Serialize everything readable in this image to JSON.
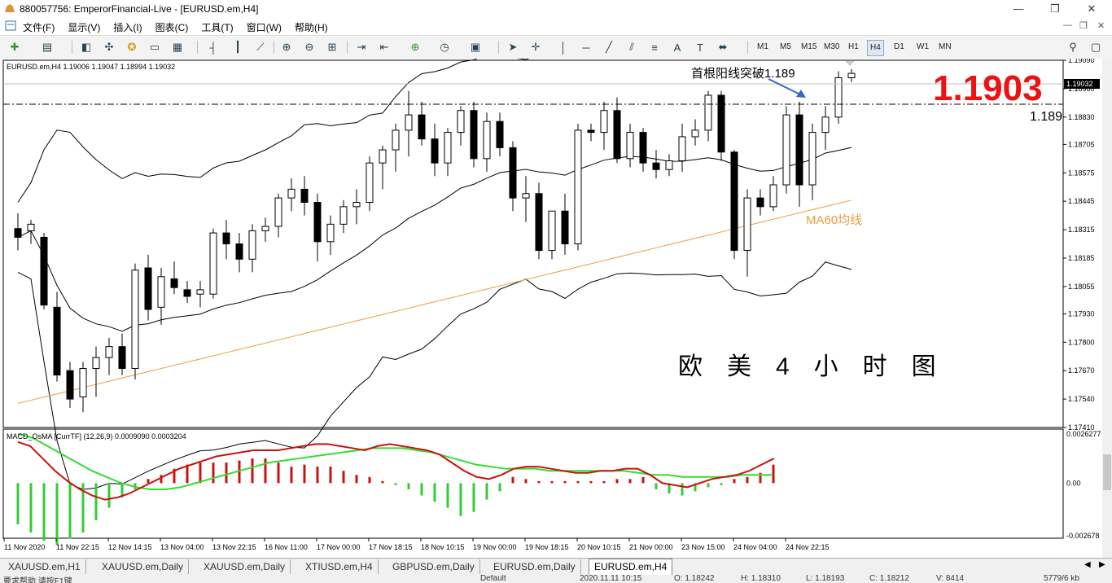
{
  "window": {
    "title": "880057756: EmperorFinancial-Live - [EURUSD.em,H4]",
    "controls": [
      "—",
      "❐",
      "✕"
    ]
  },
  "menu": {
    "items": [
      "文件(F)",
      "显示(V)",
      "插入(I)",
      "图表(C)",
      "工具(T)",
      "窗口(W)",
      "帮助(H)"
    ]
  },
  "toolbar": {
    "timeframes": [
      "M1",
      "M5",
      "M15",
      "M30",
      "H1",
      "H4",
      "D1",
      "W1",
      "MN"
    ],
    "active_timeframe": "H4"
  },
  "chart": {
    "header": "EURUSD.em,H4  1.19006 1.19047 1.18994 1.19032",
    "current_price_tag": "1.19032",
    "annotation_breakout": "首根阳线突破1.189",
    "annotation_price": "1.1903",
    "annotation_level": "1.189",
    "annotation_ma": "MA60均线",
    "annotation_title": "欧　美　4　小　时　图",
    "price_axis": [
      "1.19090",
      "1.18960",
      "1.18830",
      "1.18705",
      "1.18575",
      "1.18445",
      "1.18315",
      "1.18185",
      "1.18055",
      "1.17930",
      "1.17800",
      "1.17670",
      "1.17540",
      "1.17410"
    ],
    "macd_header": "MACD_OsMA [CurrTF] (12,26,9) 0.0009090 0.0003204",
    "macd_axis": [
      "0.0026277",
      "0.00",
      "-0.002678"
    ],
    "time_axis": [
      "11 Nov 2020",
      "11 Nov 22:15",
      "12 Nov 14:15",
      "13 Nov 04:00",
      "13 Nov 22:15",
      "16 Nov 11:00",
      "17 Nov 00:00",
      "17 Nov 18:15",
      "18 Nov 10:15",
      "19 Nov 00:00",
      "19 Nov 18:15",
      "20 Nov 10:15",
      "21 Nov 00:00",
      "23 Nov 15:00",
      "24 Nov 04:00",
      "24 Nov 22:15"
    ],
    "colors": {
      "bull": "#ffffff",
      "bear": "#000000",
      "ma60": "#e8a040",
      "macd_signal": "#33dd33",
      "macd_main": "#cc1111",
      "hist_pos": "#cc1111",
      "hist_neg": "#33cc33",
      "annotation_red": "#ee1111",
      "arrow": "#3366cc"
    }
  },
  "tabs": [
    "XAUUSD.em,H1",
    "XAUUSD.em,Daily",
    "XAUUSD.em,Daily",
    "XTIUSD.em,H4",
    "GBPUSD.em,Daily",
    "EURUSD.em,Daily",
    "EURUSD.em,H4"
  ],
  "active_tab": "EURUSD.em,H4",
  "status": {
    "help": "要求帮助,请按F1键",
    "profile": "Default",
    "datetime": "2020.11.11 10:15",
    "open": "O: 1.18242",
    "high": "H: 1.18310",
    "low": "L: 1.18193",
    "close": "C: 1.18212",
    "volume": "V: 8414",
    "traffic": "5779/6 kb"
  },
  "chart_data": {
    "type": "candlestick",
    "symbol": "EURUSD.em",
    "timeframe": "H4",
    "ylim": [
      1.1741,
      1.1909
    ],
    "candles": [
      [
        1.1832,
        1.1839,
        1.1822,
        1.1828
      ],
      [
        1.1831,
        1.1836,
        1.1825,
        1.1834
      ],
      [
        1.1828,
        1.183,
        1.1795,
        1.1797
      ],
      [
        1.1796,
        1.1803,
        1.1762,
        1.1765
      ],
      [
        1.1767,
        1.1771,
        1.175,
        1.1754
      ],
      [
        1.1755,
        1.1771,
        1.1748,
        1.1768
      ],
      [
        1.1768,
        1.1778,
        1.1755,
        1.1773
      ],
      [
        1.1773,
        1.1782,
        1.1765,
        1.1778
      ],
      [
        1.1778,
        1.1784,
        1.1765,
        1.1768
      ],
      [
        1.1768,
        1.1816,
        1.1763,
        1.1813
      ],
      [
        1.1814,
        1.182,
        1.179,
        1.1795
      ],
      [
        1.1796,
        1.1814,
        1.1788,
        1.181
      ],
      [
        1.1809,
        1.1817,
        1.1802,
        1.1805
      ],
      [
        1.1804,
        1.1808,
        1.1798,
        1.1801
      ],
      [
        1.1802,
        1.1808,
        1.1796,
        1.1804
      ],
      [
        1.1802,
        1.1832,
        1.18,
        1.183
      ],
      [
        1.183,
        1.1836,
        1.1818,
        1.1825
      ],
      [
        1.1825,
        1.183,
        1.1812,
        1.1818
      ],
      [
        1.1818,
        1.1834,
        1.1812,
        1.1831
      ],
      [
        1.1831,
        1.1837,
        1.1826,
        1.1833
      ],
      [
        1.1833,
        1.1848,
        1.1828,
        1.1846
      ],
      [
        1.1846,
        1.1855,
        1.184,
        1.185
      ],
      [
        1.185,
        1.1856,
        1.1838,
        1.1844
      ],
      [
        1.1844,
        1.1848,
        1.1817,
        1.1826
      ],
      [
        1.1826,
        1.1838,
        1.182,
        1.1834
      ],
      [
        1.1834,
        1.1845,
        1.183,
        1.1842
      ],
      [
        1.1842,
        1.185,
        1.1834,
        1.1844
      ],
      [
        1.1844,
        1.1865,
        1.184,
        1.1862
      ],
      [
        1.1862,
        1.187,
        1.185,
        1.1868
      ],
      [
        1.1868,
        1.188,
        1.1858,
        1.1877
      ],
      [
        1.1877,
        1.1895,
        1.1865,
        1.1884
      ],
      [
        1.1884,
        1.189,
        1.187,
        1.1873
      ],
      [
        1.1873,
        1.188,
        1.1856,
        1.1862
      ],
      [
        1.1862,
        1.1878,
        1.1856,
        1.1876
      ],
      [
        1.1876,
        1.1888,
        1.187,
        1.1886
      ],
      [
        1.1886,
        1.189,
        1.186,
        1.1864
      ],
      [
        1.1864,
        1.1885,
        1.1858,
        1.1881
      ],
      [
        1.1881,
        1.1885,
        1.1865,
        1.1869
      ],
      [
        1.1869,
        1.1872,
        1.184,
        1.1846
      ],
      [
        1.1846,
        1.1856,
        1.1835,
        1.1848
      ],
      [
        1.1848,
        1.1853,
        1.1818,
        1.1822
      ],
      [
        1.1822,
        1.184,
        1.1818,
        1.184
      ],
      [
        1.184,
        1.1848,
        1.182,
        1.1825
      ],
      [
        1.1825,
        1.188,
        1.1822,
        1.1877
      ],
      [
        1.1877,
        1.188,
        1.1872,
        1.1876
      ],
      [
        1.1876,
        1.189,
        1.1868,
        1.1886
      ],
      [
        1.1886,
        1.1892,
        1.1862,
        1.1864
      ],
      [
        1.1864,
        1.188,
        1.186,
        1.1876
      ],
      [
        1.1876,
        1.1878,
        1.1858,
        1.1862
      ],
      [
        1.1862,
        1.1868,
        1.1855,
        1.1859
      ],
      [
        1.1859,
        1.1866,
        1.1856,
        1.1863
      ],
      [
        1.1863,
        1.188,
        1.1858,
        1.1874
      ],
      [
        1.1874,
        1.1882,
        1.187,
        1.1877
      ],
      [
        1.1877,
        1.1895,
        1.1872,
        1.1893
      ],
      [
        1.1893,
        1.1895,
        1.1863,
        1.1867
      ],
      [
        1.1867,
        1.1868,
        1.1818,
        1.1822
      ],
      [
        1.1822,
        1.185,
        1.181,
        1.1846
      ],
      [
        1.1846,
        1.185,
        1.1838,
        1.1842
      ],
      [
        1.1842,
        1.1856,
        1.184,
        1.1852
      ],
      [
        1.1852,
        1.1888,
        1.1848,
        1.1884
      ],
      [
        1.1884,
        1.189,
        1.1842,
        1.1852
      ],
      [
        1.1852,
        1.188,
        1.1845,
        1.1876
      ],
      [
        1.1876,
        1.1888,
        1.1868,
        1.1883
      ],
      [
        1.1883,
        1.1904,
        1.188,
        1.1901
      ],
      [
        1.1901,
        1.1905,
        1.1899,
        1.1903
      ]
    ],
    "macd_main": [
      0.002,
      0.0018,
      0.0012,
      0.0006,
      0.0001,
      -0.0003,
      -0.0006,
      -0.0008,
      -0.0007,
      -0.0005,
      -0.0002,
      0.0001,
      0.0004,
      0.0007,
      0.0009,
      0.0011,
      0.0013,
      0.0014,
      0.0015,
      0.0016,
      0.0016,
      0.0016,
      0.0017,
      0.0018,
      0.0019,
      0.0019,
      0.0018,
      0.0017,
      0.0016,
      0.0018,
      0.0019,
      0.0018,
      0.0017,
      0.0016,
      0.0014,
      0.001,
      0.0006,
      0.0003,
      0.0002,
      0.0004,
      0.0007,
      0.0008,
      0.0008,
      0.0007,
      0.0006,
      0.0005,
      0.0005,
      0.0006,
      0.0006,
      0.0007,
      0.0007,
      0.0004,
      0.0,
      -0.0001,
      -0.0002,
      0.0,
      0.0002,
      0.0003,
      0.0004,
      0.0006,
      0.0009,
      0.0012
    ],
    "macd_signal": [
      0.0024,
      0.0022,
      0.0018,
      0.0014,
      0.001,
      0.0006,
      0.0003,
      0.0,
      -0.0002,
      -0.0003,
      -0.0003,
      -0.0002,
      0.0,
      0.0002,
      0.0004,
      0.0006,
      0.0008,
      0.001,
      0.0011,
      0.0012,
      0.0013,
      0.0014,
      0.0015,
      0.0016,
      0.0017,
      0.0017,
      0.0017,
      0.0016,
      0.0015,
      0.0013,
      0.0011,
      0.0009,
      0.0008,
      0.0007,
      0.0007,
      0.0007,
      0.0006,
      0.0006,
      0.0006,
      0.0006,
      0.0006,
      0.0006,
      0.0005,
      0.0004,
      0.0004,
      0.0003,
      0.0003,
      0.0003,
      0.0003,
      0.0004,
      0.0004,
      0.0004
    ],
    "macd_hist": [
      -0.002,
      -0.0024,
      -0.0028,
      -0.003,
      -0.0027,
      -0.0024,
      -0.0018,
      -0.0012,
      -0.0007,
      -0.0003,
      0.0002,
      0.0004,
      0.0007,
      0.0009,
      0.001,
      0.001,
      0.001,
      0.0011,
      0.0012,
      0.0012,
      0.001,
      0.0008,
      0.0009,
      0.0008,
      0.0008,
      0.0006,
      0.0004,
      0.0003,
      0.0001,
      -0.0001,
      -0.0003,
      -0.0006,
      -0.0009,
      -0.0012,
      -0.0016,
      -0.0014,
      -0.0008,
      -0.0004,
      0.0003,
      0.0002,
      0.0001,
      0.0001,
      0.0001,
      0.0001,
      0.0001,
      0.0001,
      0.0002,
      0.0002,
      0.0003,
      -0.0003,
      -0.0005,
      -0.0006,
      -0.0004,
      -0.0002,
      -0.0001,
      0.0002,
      0.0003,
      0.0005,
      0.0009
    ]
  }
}
